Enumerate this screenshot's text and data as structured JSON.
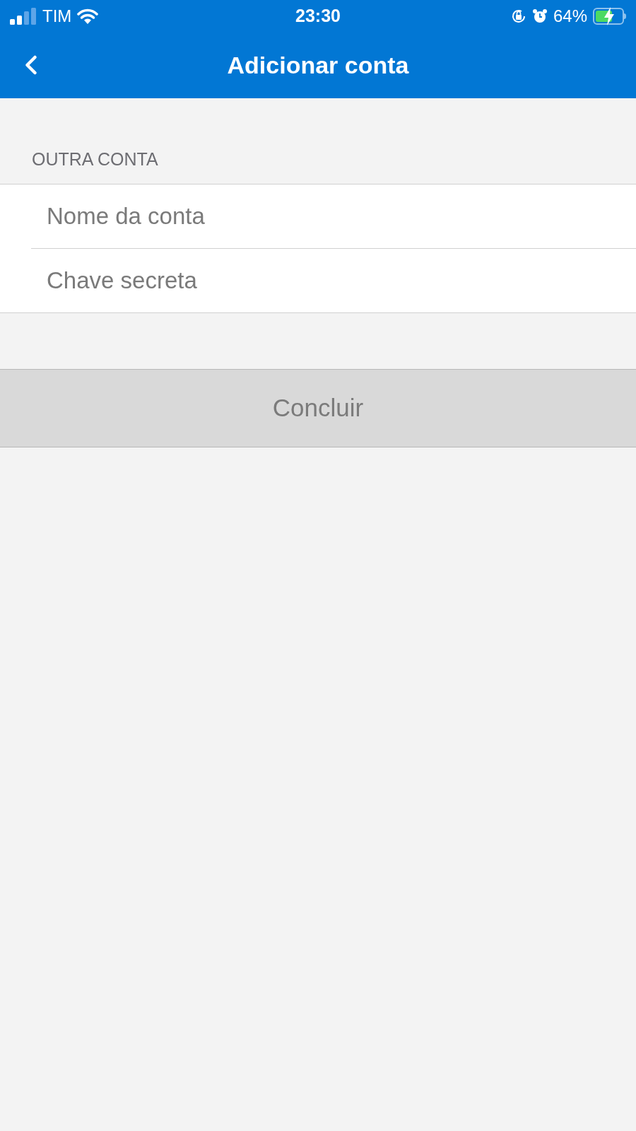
{
  "status_bar": {
    "carrier": "TIM",
    "time": "23:30",
    "battery": "64%"
  },
  "header": {
    "title": "Adicionar conta"
  },
  "section": {
    "label": "OUTRA CONTA"
  },
  "fields": [
    {
      "placeholder": "Nome da conta"
    },
    {
      "placeholder": "Chave secreta"
    }
  ],
  "button": {
    "label": "Concluir",
    "disabled": true
  }
}
